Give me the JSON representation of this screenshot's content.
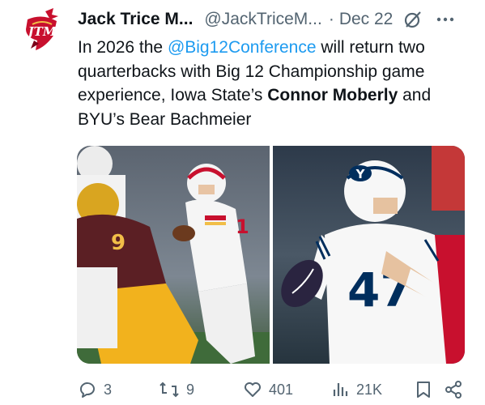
{
  "tweet": {
    "author_name": "Jack Trice M...",
    "handle": "@JackTriceM...",
    "separator": "·",
    "date": "Dec 22",
    "text": {
      "part1": "In 2026 the ",
      "mention": "@Big12Conference",
      "part2": " will return two quarterbacks with Big 12 Championship game experience, Iowa State’s ",
      "bold_name": "Connor Moberly",
      "part3": " and BYU’s Bear Bachmeier"
    },
    "avatar_logo_text": "JTM"
  },
  "media": {
    "left_photo": {
      "jersey_number": "1"
    },
    "right_photo": {
      "jersey_number": "47",
      "helmet_logo": "Y"
    }
  },
  "actions": {
    "replies": "3",
    "reposts": "9",
    "likes": "401",
    "views": "21K"
  },
  "colors": {
    "link": "#1d9bf0",
    "muted": "#536471",
    "text": "#0f1419",
    "cyclone_red": "#c8102e",
    "byu_blue": "#002e5d"
  }
}
